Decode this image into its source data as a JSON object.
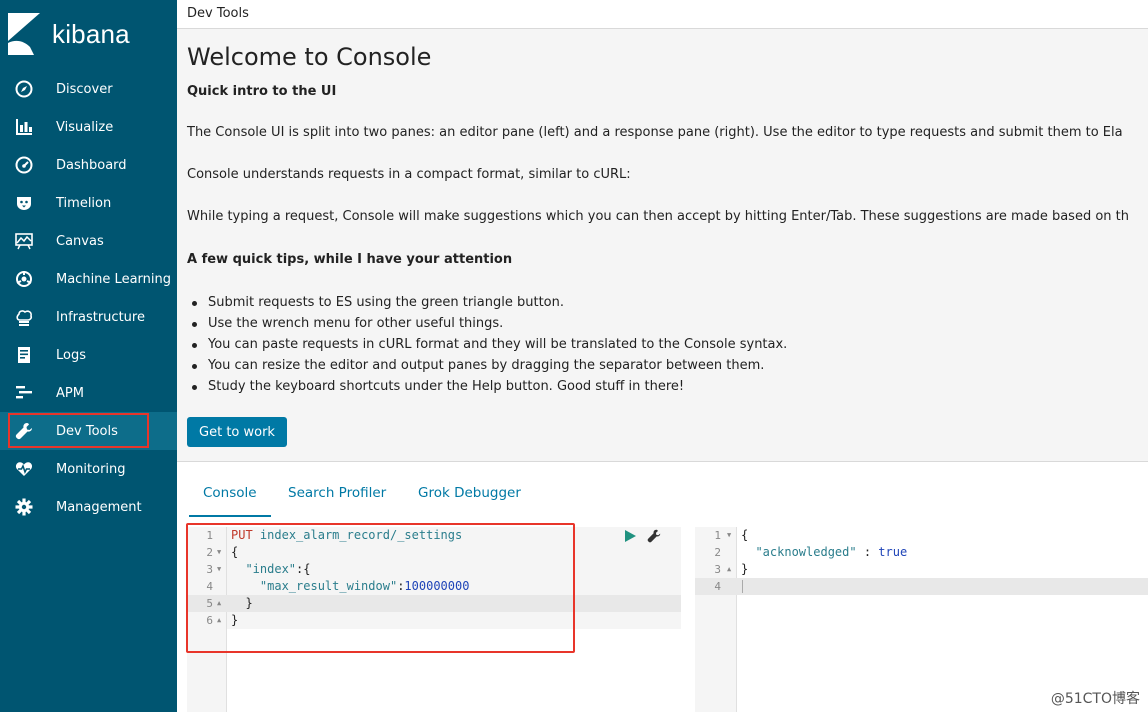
{
  "brand": {
    "name": "kibana"
  },
  "sidebar": {
    "items": [
      {
        "label": "Discover",
        "icon": "compass-icon"
      },
      {
        "label": "Visualize",
        "icon": "bar-chart-icon"
      },
      {
        "label": "Dashboard",
        "icon": "dashboard-icon"
      },
      {
        "label": "Timelion",
        "icon": "timelion-icon"
      },
      {
        "label": "Canvas",
        "icon": "canvas-icon"
      },
      {
        "label": "Machine Learning",
        "icon": "machine-learning-icon"
      },
      {
        "label": "Infrastructure",
        "icon": "infrastructure-icon"
      },
      {
        "label": "Logs",
        "icon": "logs-icon"
      },
      {
        "label": "APM",
        "icon": "apm-icon"
      },
      {
        "label": "Dev Tools",
        "icon": "wrench-icon",
        "active": true
      },
      {
        "label": "Monitoring",
        "icon": "heartbeat-icon"
      },
      {
        "label": "Management",
        "icon": "gear-icon"
      }
    ]
  },
  "header": {
    "breadcrumb": "Dev Tools"
  },
  "welcome": {
    "title": "Welcome to Console",
    "subtitle": "Quick intro to the UI",
    "p1": "The Console UI is split into two panes: an editor pane (left) and a response pane (right). Use the editor to type requests and submit them to Ela",
    "p2": "Console understands requests in a compact format, similar to cURL:",
    "p3": "While typing a request, Console will make suggestions which you can then accept by hitting Enter/Tab. These suggestions are made based on th",
    "tips_heading": "A few quick tips, while I have your attention",
    "tips": [
      "Submit requests to ES using the green triangle button.",
      "Use the wrench menu for other useful things.",
      "You can paste requests in cURL format and they will be translated to the Console syntax.",
      "You can resize the editor and output panes by dragging the separator between them.",
      "Study the keyboard shortcuts under the Help button. Good stuff in there!"
    ],
    "button": "Get to work"
  },
  "tabs": [
    "Console",
    "Search Profiler",
    "Grok Debugger"
  ],
  "editor": {
    "lines": [
      "1",
      "2",
      "3",
      "4",
      "5",
      "6"
    ],
    "method": "PUT",
    "path": "index_alarm_record/_settings",
    "open_brace": "{",
    "key_index": "\"index\"",
    "colon_brace": ":{",
    "key_max": "\"max_result_window\"",
    "colon": ":",
    "value": "100000000",
    "close_inner": "}",
    "close_outer": "}"
  },
  "output": {
    "lines": [
      "1",
      "2",
      "3",
      "4"
    ],
    "open_brace": "{",
    "key": "\"acknowledged\"",
    "sep": " : ",
    "value": "true",
    "close_brace": "}"
  },
  "colors": {
    "sidebar_bg": "#005571",
    "accent": "#0079a5",
    "highlight_box": "#e8352a",
    "run_button": "#209280"
  },
  "watermark": "@51CTO博客"
}
